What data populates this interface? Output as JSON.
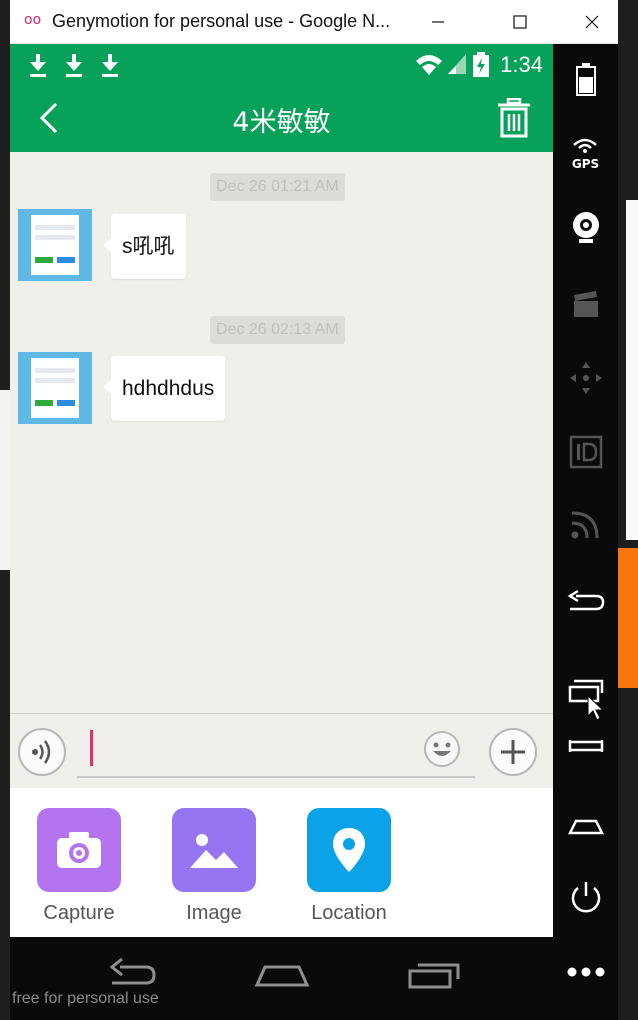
{
  "window": {
    "title": "Genymotion for personal use - Google N...",
    "logo_glyph": "oo"
  },
  "status_bar": {
    "time": "1:34"
  },
  "chat": {
    "contact_name": "4米敏敏",
    "messages": [
      {
        "timestamp": "Dec 26 01:21 AM",
        "text": "s吼吼"
      },
      {
        "timestamp": "Dec 26 02:13 AM",
        "text": "hdhdhdus"
      }
    ]
  },
  "input": {
    "value": ""
  },
  "tools": [
    {
      "label": "Capture",
      "icon": "camera-icon",
      "color": "#b474f0"
    },
    {
      "label": "Image",
      "icon": "image-icon",
      "color": "#9575f2"
    },
    {
      "label": "Location",
      "icon": "location-pin-icon",
      "color": "#0ba2e8"
    }
  ],
  "side_toolbar": {
    "gps_label": "GPS"
  },
  "watermark": "free for personal use",
  "colors": {
    "app_bar": "#07a159",
    "caret": "#e4316d"
  }
}
